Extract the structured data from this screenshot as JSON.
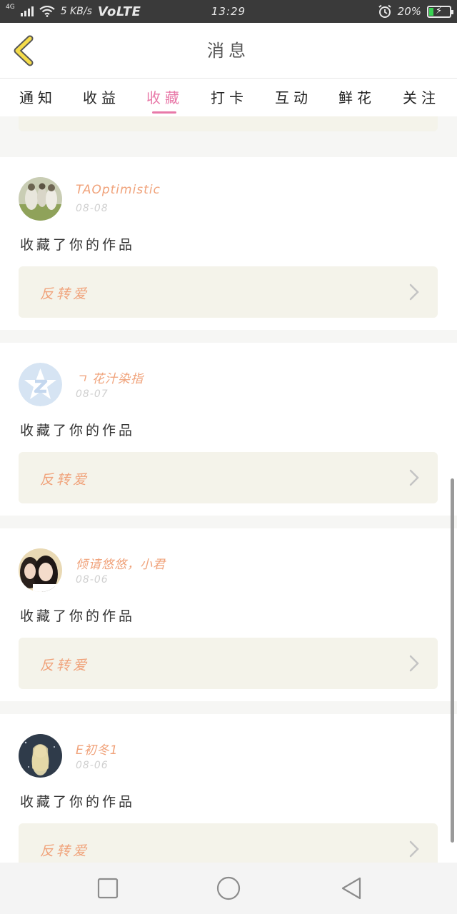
{
  "status_bar": {
    "signal_label": "4G",
    "net_speed": "5 KB/s",
    "volte": "VoLTE",
    "time": "13:29",
    "battery_pct": "20%",
    "battery_level": 0.2
  },
  "header": {
    "title": "消息"
  },
  "tabs": [
    {
      "label": "通知",
      "active": false
    },
    {
      "label": "收益",
      "active": false
    },
    {
      "label": "收藏",
      "active": true
    },
    {
      "label": "打卡",
      "active": false
    },
    {
      "label": "互动",
      "active": false
    },
    {
      "label": "鲜花",
      "active": false
    },
    {
      "label": "关注",
      "active": false
    }
  ],
  "colors": {
    "accent": "#e879a8",
    "username": "#f0a27a",
    "box_bg": "#f4f3ea"
  },
  "cards": [
    {
      "username": "TAOptimistic",
      "date": "08-08",
      "action": "收藏了你的作品",
      "work_title": "反转爱"
    },
    {
      "username": "ㄱ 花汁染指",
      "date": "08-07",
      "action": "收藏了你的作品",
      "work_title": "反转爱"
    },
    {
      "username": "倾请悠悠，小君",
      "date": "08-06",
      "action": "收藏了你的作品",
      "work_title": "反转爱"
    },
    {
      "username": "E初冬1",
      "date": "08-06",
      "action": "收藏了你的作品",
      "work_title": "反转爱"
    }
  ]
}
